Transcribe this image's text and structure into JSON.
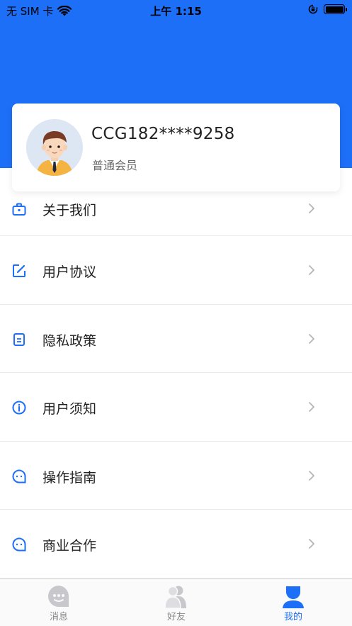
{
  "status_bar": {
    "carrier": "无 SIM 卡",
    "time": "上午 1:15"
  },
  "profile": {
    "name": "CCG182****9258",
    "level": "普通会员"
  },
  "menu": {
    "items": [
      {
        "label": "关于我们",
        "icon": "briefcase-icon"
      },
      {
        "label": "用户协议",
        "icon": "edit-icon"
      },
      {
        "label": "隐私政策",
        "icon": "document-icon"
      },
      {
        "label": "用户须知",
        "icon": "info-icon"
      },
      {
        "label": "操作指南",
        "icon": "chat-bubble-icon"
      },
      {
        "label": "商业合作",
        "icon": "chat-bubble-icon"
      }
    ]
  },
  "tab_bar": {
    "tabs": [
      {
        "label": "消息",
        "active": false
      },
      {
        "label": "好友",
        "active": false
      },
      {
        "label": "我的",
        "active": true
      }
    ]
  },
  "colors": {
    "accent": "#1d6ff7",
    "inactive_tab": "#c7c7cc"
  }
}
